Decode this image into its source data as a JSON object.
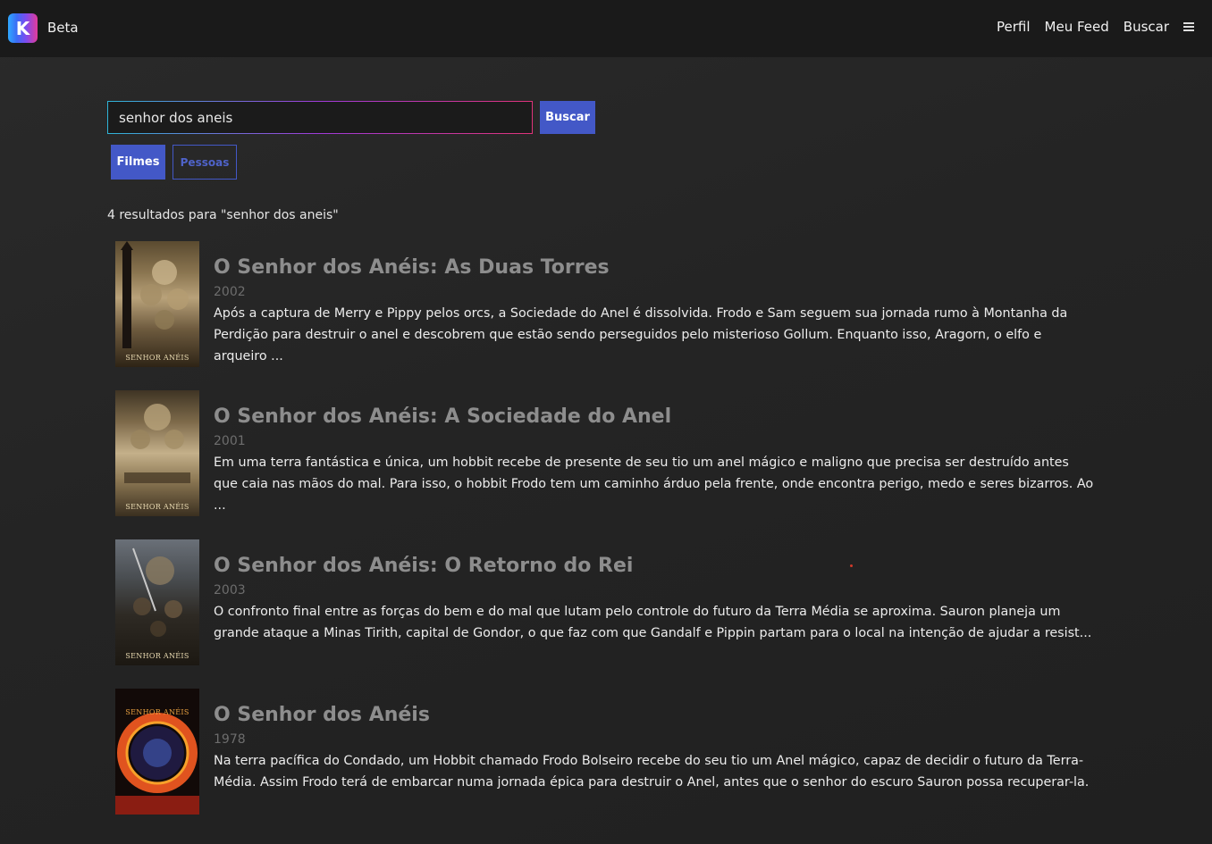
{
  "header": {
    "logo_letter": "K",
    "beta_label": "Beta",
    "nav": [
      "Perfil",
      "Meu Feed",
      "Buscar"
    ],
    "menu_icon": "hamburger-icon"
  },
  "search": {
    "value": "senhor dos aneis",
    "button_label": "Buscar"
  },
  "tabs": {
    "filmes": "Filmes",
    "pessoas": "Pessoas",
    "active": "Filmes"
  },
  "results_count_text": "4 resultados para \"senhor dos aneis\"",
  "results": [
    {
      "title": "O Senhor dos Anéis: As Duas Torres",
      "year": "2002",
      "description": "Após a captura de Merry e Pippy pelos orcs, a Sociedade do Anel é dissolvida. Frodo e Sam seguem sua jornada rumo à Montanha da Perdição para destruir o anel e descobrem que estão sendo perseguidos pelo misterioso Gollum. Enquanto isso, Aragorn, o elfo e arqueiro ...",
      "poster_text": "SENHOR ANÉIS"
    },
    {
      "title": "O Senhor dos Anéis: A Sociedade do Anel",
      "year": "2001",
      "description": "Em uma terra fantástica e única, um hobbit recebe de presente de seu tio um anel mágico e maligno que precisa ser destruído antes que caia nas mãos do mal. Para isso, o hobbit Frodo tem um caminho árduo pela frente, onde encontra perigo, medo e seres bizarros. Ao ...",
      "poster_text": "SENHOR ANÉIS"
    },
    {
      "title": "O Senhor dos Anéis: O Retorno do Rei",
      "year": "2003",
      "description": "O confronto final entre as forças do bem e do mal que lutam pelo controle do futuro da Terra Média se aproxima. Sauron planeja um grande ataque a Minas Tirith, capital de Gondor, o que faz com que Gandalf e Pippin partam para o local na intenção de ajudar a resist...",
      "poster_text": "SENHOR ANÉIS"
    },
    {
      "title": "O Senhor dos Anéis",
      "year": "1978",
      "description": "Na terra pacífica do Condado, um Hobbit chamado Frodo Bolseiro recebe do seu tio um Anel mágico, capaz de decidir o futuro da Terra-Média. Assim Frodo terá de embarcar numa jornada épica para destruir o Anel, antes que o senhor do escuro Sauron possa recuperar-la.",
      "poster_text": "SENHOR ANÉIS"
    }
  ],
  "colors": {
    "accent": "#4358c7",
    "background": "#262626",
    "header": "#1a1a1a"
  }
}
